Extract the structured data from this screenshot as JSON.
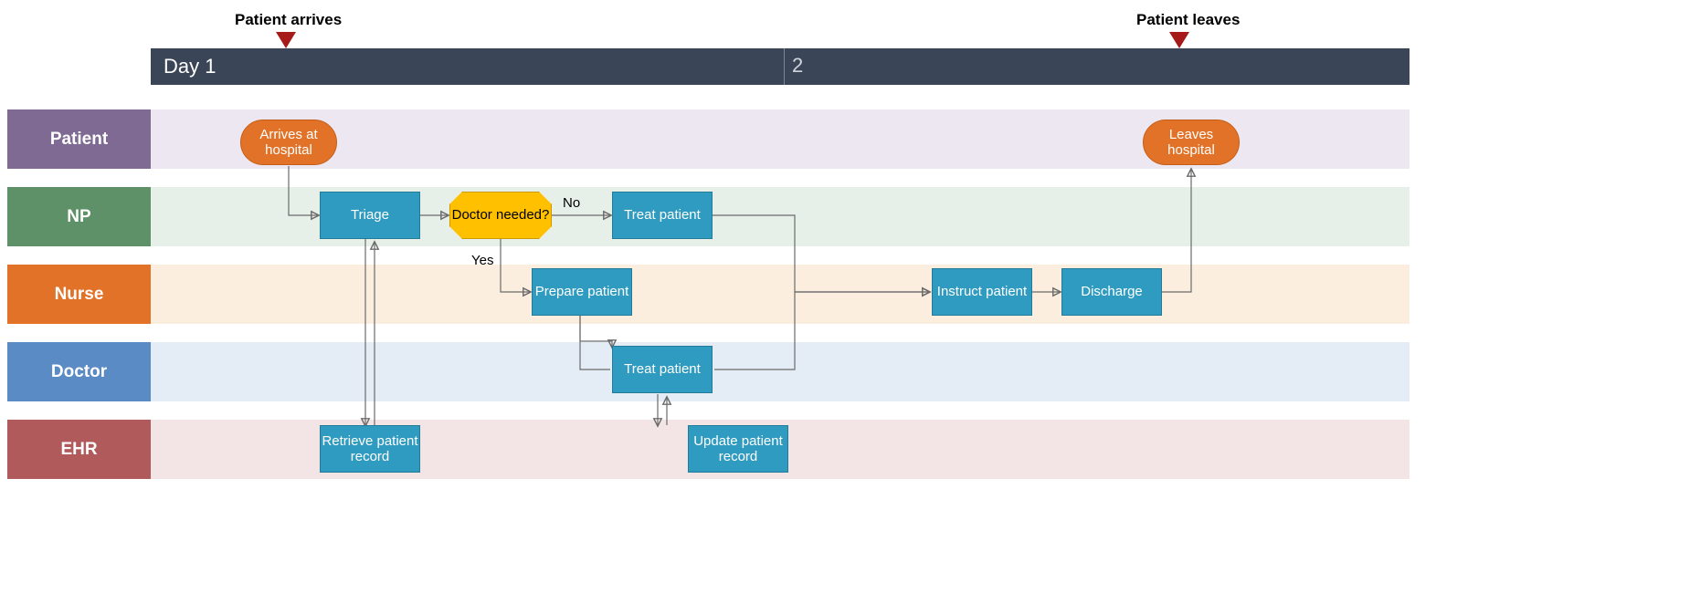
{
  "timeline": {
    "day1_label": "Day 1",
    "day2_label": "2",
    "events": {
      "arrive": "Patient arrives",
      "leave": "Patient leaves"
    }
  },
  "lanes": {
    "patient": {
      "label": "Patient",
      "label_bg": "#7e6a93",
      "body_bg": "#ece7f0"
    },
    "np": {
      "label": "NP",
      "label_bg": "#5f9169",
      "body_bg": "#e6efe8"
    },
    "nurse": {
      "label": "Nurse",
      "label_bg": "#e27227",
      "body_bg": "#fbeedf"
    },
    "doctor": {
      "label": "Doctor",
      "label_bg": "#5a8bc4",
      "body_bg": "#e4ecf5"
    },
    "ehr": {
      "label": "EHR",
      "label_bg": "#b15a5c",
      "body_bg": "#f3e5e5"
    }
  },
  "shapes": {
    "arrives": {
      "text": "Arrives at hospital"
    },
    "leaves": {
      "text": "Leaves hospital"
    },
    "triage": {
      "text": "Triage"
    },
    "doctor_needed": {
      "text": "Doctor needed?"
    },
    "treat_np": {
      "text": "Treat patient"
    },
    "prepare": {
      "text": "Prepare patient"
    },
    "treat_doctor": {
      "text": "Treat patient"
    },
    "retrieve_record": {
      "text": "Retrieve patient record"
    },
    "update_record": {
      "text": "Update patient record"
    },
    "instruct": {
      "text": "Instruct patient"
    },
    "discharge": {
      "text": "Discharge"
    }
  },
  "edge_labels": {
    "no": "No",
    "yes": "Yes"
  }
}
